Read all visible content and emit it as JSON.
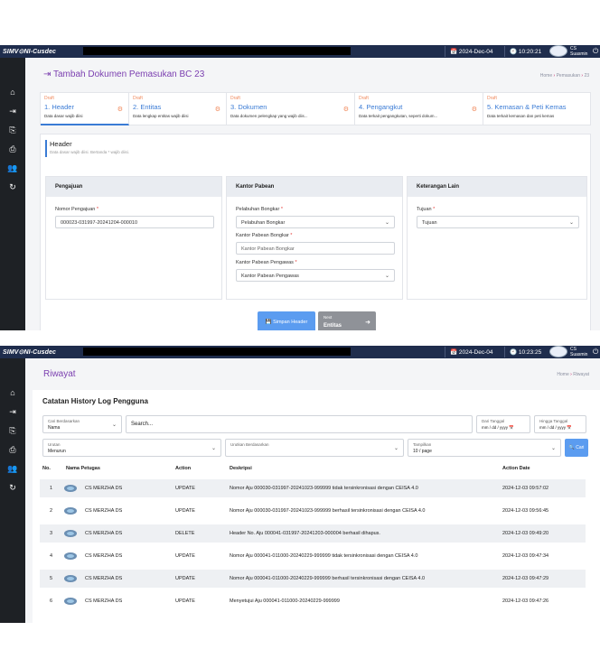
{
  "topbar": {
    "brand": "SIMV⊙NI-Cusdec",
    "date": "📅 2024-Dec-04",
    "time1": "🕙 10:20:21",
    "time2": "🕙 10:23:25",
    "user_line1": "CS",
    "user_line2": "Suasmin",
    "power": "⏻"
  },
  "sidebar_icons": [
    "home-icon",
    "import-icon",
    "export-icon",
    "print-icon",
    "users-icon",
    "history-icon"
  ],
  "sidebar_glyphs": [
    "⌂",
    "⇥",
    "⎘",
    "⎙",
    "👥",
    "↻"
  ],
  "form": {
    "title_icon": "⇥",
    "title": "Tambah Dokumen Pemasukan BC 23",
    "crumb_home": "Home",
    "crumb_sep": "›",
    "crumb_1": "Pemasukan",
    "crumb_2": "23",
    "steps": [
      {
        "draft": "Draft",
        "name": "1. Header",
        "desc": "Data dasar wajib diisi"
      },
      {
        "draft": "Draft",
        "name": "2. Entitas",
        "desc": "Data lengkap entitas wajib diisi"
      },
      {
        "draft": "Draft",
        "name": "3. Dokumen",
        "desc": "Data dokumen pelengkap yang wajib diis..."
      },
      {
        "draft": "Draft",
        "name": "4. Pengangkut",
        "desc": "Data terkait pengangkutan, seperti dokum..."
      },
      {
        "draft": "Draft",
        "name": "5. Kemasan & Peti Kemas",
        "desc": "Data terkait kemasan dan peti kemas"
      }
    ],
    "section_title": "Header",
    "section_sub": "Data dasar wajib diisi. Bertanda * wajib diisi.",
    "pengajuan": {
      "title": "Pengajuan",
      "label": "Nomor Pengajuan",
      "value": "000023-031997-20241204-000010"
    },
    "kantor": {
      "title": "Kantor Pabean",
      "pelabuhan_label": "Pelabuhan Bongkar",
      "pelabuhan_value": "Pelabuhan Bongkar",
      "bongkar_label": "Kantor Pabean Bongkar",
      "bongkar_placeholder": "Kantor Pabean Bongkar",
      "pengawas_label": "Kantor Pabean Pengawas",
      "pengawas_value": "Kantor Pabean Pengawas"
    },
    "lain": {
      "title": "Keterangan Lain",
      "label": "Tujuan",
      "value": "Tujuan"
    },
    "save_button": "💾 Simpan Header",
    "next_small": "Next",
    "next_label": "Entitas",
    "next_arrow": "➜"
  },
  "history": {
    "title": "Riwayat",
    "crumb_home": "Home",
    "crumb_sep": "›",
    "crumb_1": "Riwayat",
    "card_title": "Catatan History Log Pengguna",
    "cari_label": "Cari Berdasarkan",
    "cari_value": "Nama",
    "search_placeholder": "Search...",
    "dari_label": "Dari Tanggal",
    "dari_value": "mm / dd / yyyy 📅",
    "hingga_label": "Hingga Tanggal",
    "hingga_value": "mm / dd / yyyy 📅",
    "urutan_label": "Urutan",
    "urutan_value": "Menurun",
    "urutkan_label": "Urutkan Berdasarkan",
    "urutkan_value": "",
    "tampilkan_label": "Tampilkan",
    "tampilkan_value": "10 / page",
    "cari_button": "🔍 Cari",
    "columns": [
      "No.",
      "Nama Petugas",
      "Action",
      "Deskripsi",
      "Action Date"
    ],
    "rows": [
      {
        "no": "1",
        "nama": "CS MERZHA DS",
        "action": "UPDATE",
        "desc": "Nomor Aju 000030-031997-20241023-999999 tidak tersinkronisasi dengan CEISA 4.0",
        "date": "2024-12-03 09:57:02"
      },
      {
        "no": "2",
        "nama": "CS MERZHA DS",
        "action": "UPDATE",
        "desc": "Nomor Aju 000030-031997-20241023-999999 berhasil tersinkronisasi dengan CEISA 4.0",
        "date": "2024-12-03 09:56:45"
      },
      {
        "no": "3",
        "nama": "CS MERZHA DS",
        "action": "DELETE",
        "desc": "Header No. Aju 000041-031997-20241203-000004 berhasil dihapus.",
        "date": "2024-12-03 09:49:20"
      },
      {
        "no": "4",
        "nama": "CS MERZHA DS",
        "action": "UPDATE",
        "desc": "Nomor Aju 000041-011000-20240229-999999 tidak tersinkronisasi dengan CEISA 4.0",
        "date": "2024-12-03 09:47:34"
      },
      {
        "no": "5",
        "nama": "CS MERZHA DS",
        "action": "UPDATE",
        "desc": "Nomor Aju 000041-011000-20240229-999999 berhasil tersinkronisasi dengan CEISA 4.0",
        "date": "2024-12-03 09:47:29"
      },
      {
        "no": "6",
        "nama": "CS MERZHA DS",
        "action": "UPDATE",
        "desc": "Menyetujui Aju 000041-011000-20240229-999999",
        "date": "2024-12-03 09:47:26"
      }
    ]
  }
}
